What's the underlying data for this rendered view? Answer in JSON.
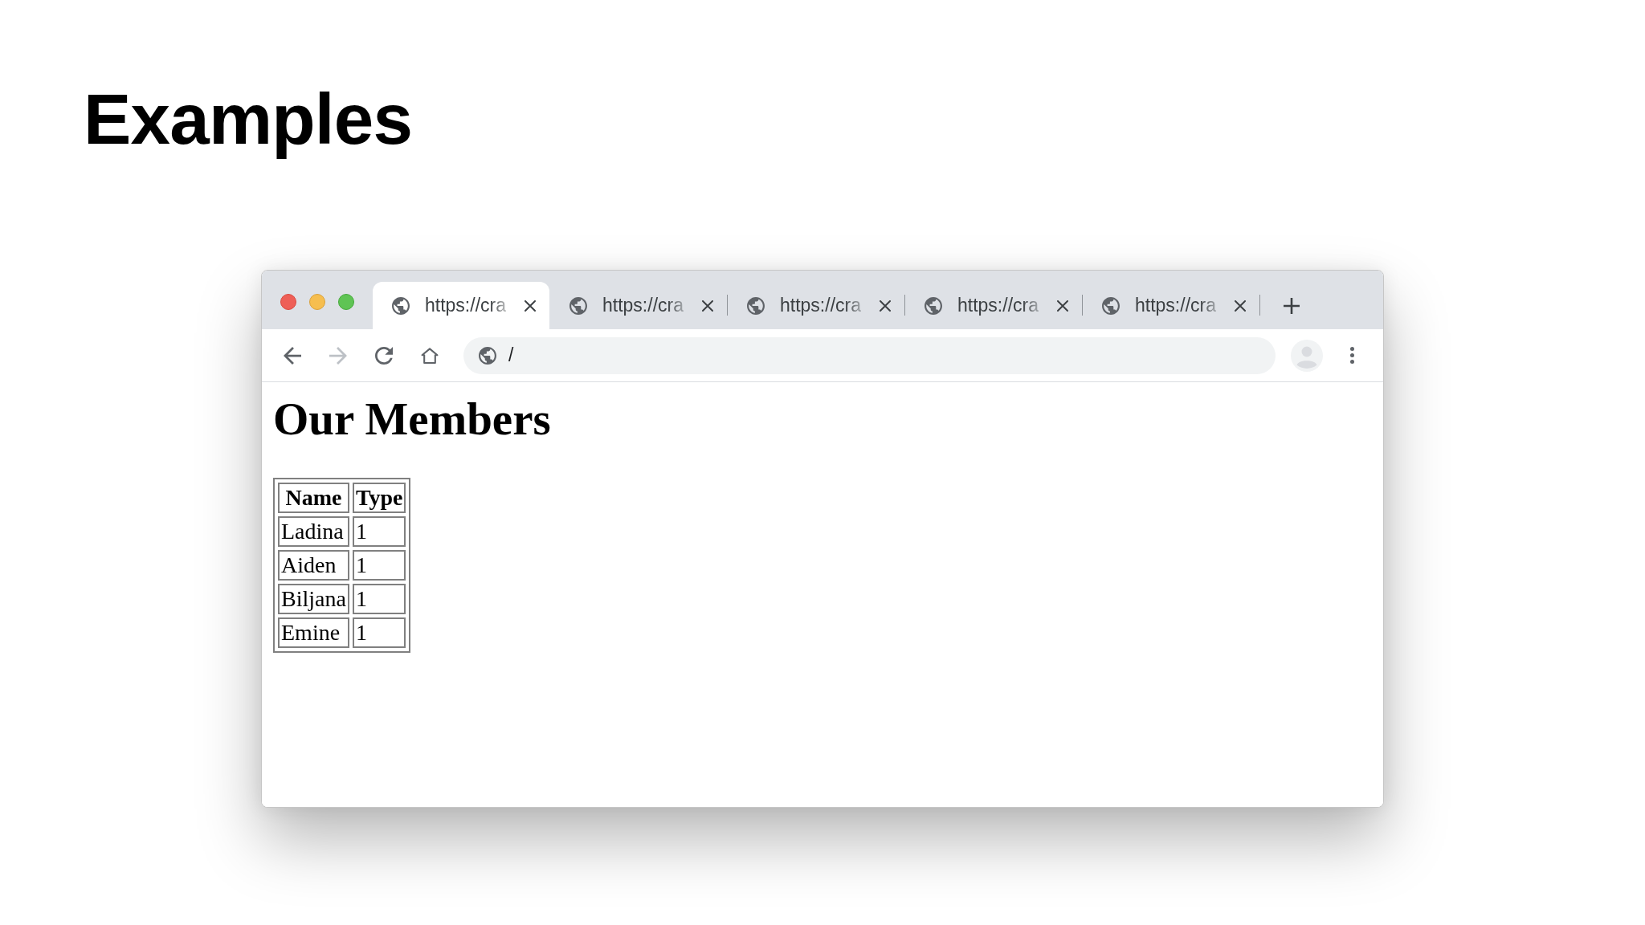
{
  "slide": {
    "title": "Examples"
  },
  "browser": {
    "tabs": [
      {
        "label": "https://cra",
        "selected": true
      },
      {
        "label": "https://cra",
        "selected": false
      },
      {
        "label": "https://cra",
        "selected": false
      },
      {
        "label": "https://cra",
        "selected": false
      },
      {
        "label": "https://cra",
        "selected": false
      }
    ],
    "nav_buttons": [
      {
        "kind": "back",
        "disabled": false
      },
      {
        "kind": "forward",
        "disabled": true
      },
      {
        "kind": "reload",
        "disabled": false
      },
      {
        "kind": "home",
        "disabled": false
      }
    ],
    "address_bar": {
      "value": "/"
    },
    "page": {
      "heading": "Our Members",
      "table": {
        "columns": [
          "Name",
          "Type"
        ],
        "rows": [
          [
            "Ladina",
            "1"
          ],
          [
            "Aiden",
            "1"
          ],
          [
            "Biljana",
            "1"
          ],
          [
            "Emine",
            "1"
          ]
        ]
      }
    }
  }
}
